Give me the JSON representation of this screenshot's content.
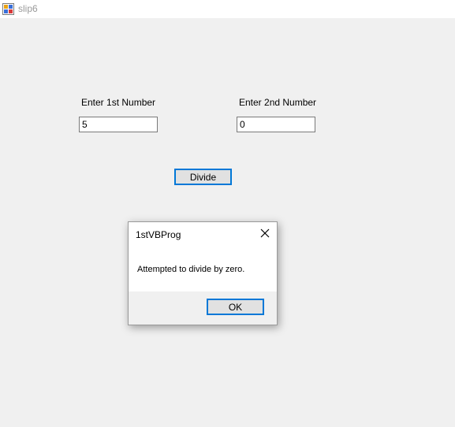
{
  "window": {
    "title": "slip6",
    "icon": "windows-form-icon"
  },
  "form": {
    "first_label": "Enter 1st Number",
    "first_value": "5",
    "second_label": "Enter 2nd Number",
    "second_value": "0",
    "divide_label": "Divide"
  },
  "dialog": {
    "title": "1stVBProg",
    "message": "Attempted to divide by zero.",
    "ok_label": "OK",
    "close_icon": "close-icon"
  },
  "colors": {
    "accent": "#0078d7",
    "form_background": "#f0f0f0"
  }
}
